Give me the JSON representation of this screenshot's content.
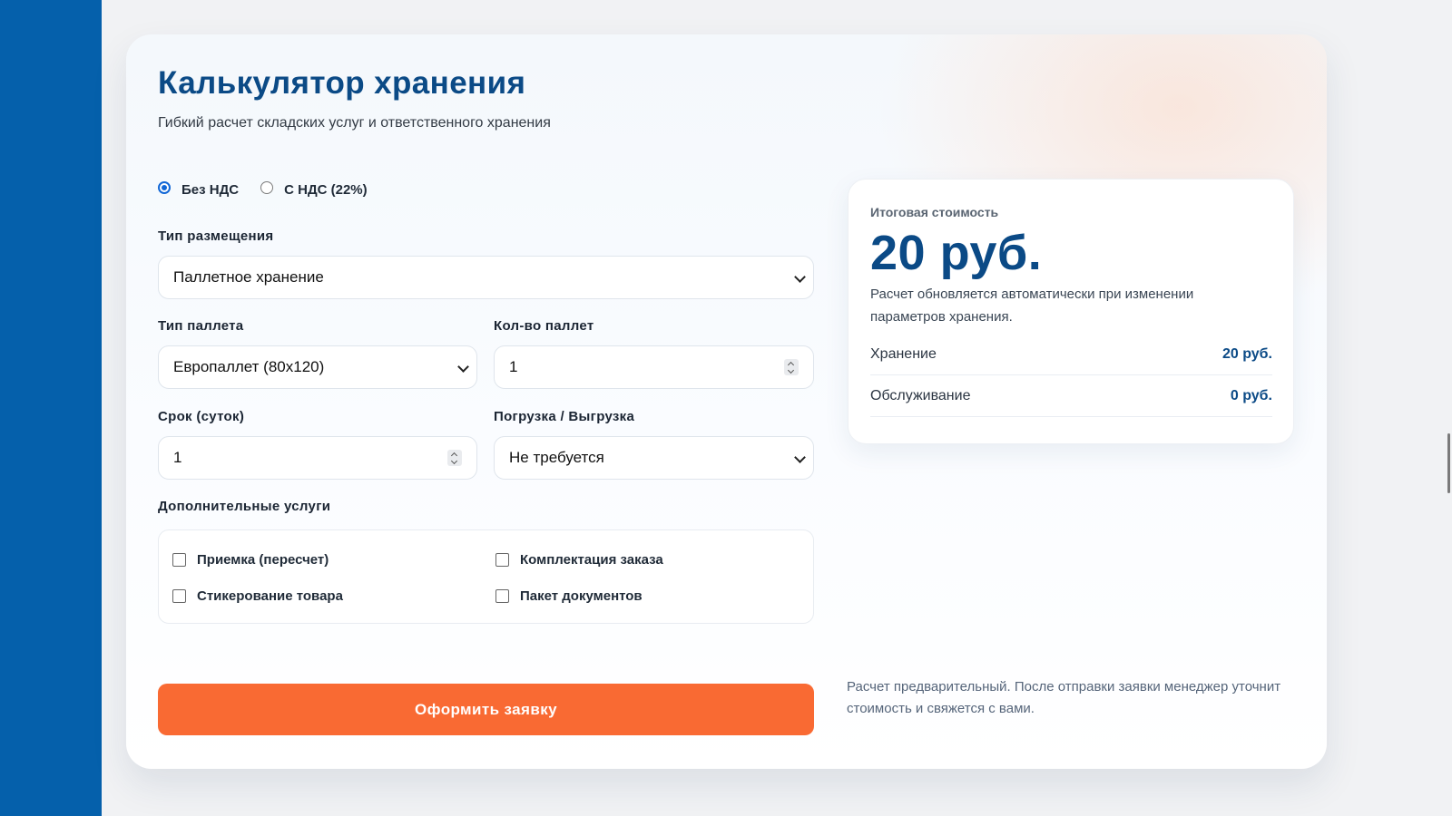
{
  "calculator": {
    "title": "Калькулятор хранения",
    "subtitle": "Гибкий расчет складских услуг и ответственного хранения",
    "vat_options": [
      {
        "label": "Без НДС",
        "selected": true
      },
      {
        "label": "С НДС (22%)",
        "selected": false
      }
    ],
    "placement": {
      "label": "Тип размещения",
      "value": "Паллетное хранение"
    },
    "pallet_type": {
      "label": "Тип паллета",
      "value": "Европаллет (80х120)"
    },
    "pallet_count": {
      "label": "Кол-во паллет",
      "value": "1"
    },
    "term": {
      "label": "Срок (суток)",
      "value": "1"
    },
    "loading": {
      "label": "Погрузка / Выгрузка",
      "value": "Не требуется"
    },
    "extras": {
      "label": "Дополнительные услуги",
      "items": [
        {
          "label": "Приемка (пересчет)",
          "checked": false
        },
        {
          "label": "Комплектация заказа",
          "checked": false
        },
        {
          "label": "Стикерование товара",
          "checked": false
        },
        {
          "label": "Пакет документов",
          "checked": false
        }
      ]
    },
    "submit_label": "Оформить заявку",
    "note": "Расчет предварительный. После отправки заявки менеджер уточнит стоимость и свяжется с вами."
  },
  "summary": {
    "caption": "Итоговая стоимость",
    "total": "20 руб.",
    "description": "Расчет обновляется автоматически при изменении параметров хранения.",
    "rows": [
      {
        "label": "Хранение",
        "value": "20 руб."
      },
      {
        "label": "Обслуживание",
        "value": "0 руб."
      }
    ]
  },
  "colors": {
    "sidebar": "#0560ab",
    "title": "#0b4a86",
    "accent_button": "#f96a33",
    "radio_selected": "#1167d6"
  }
}
